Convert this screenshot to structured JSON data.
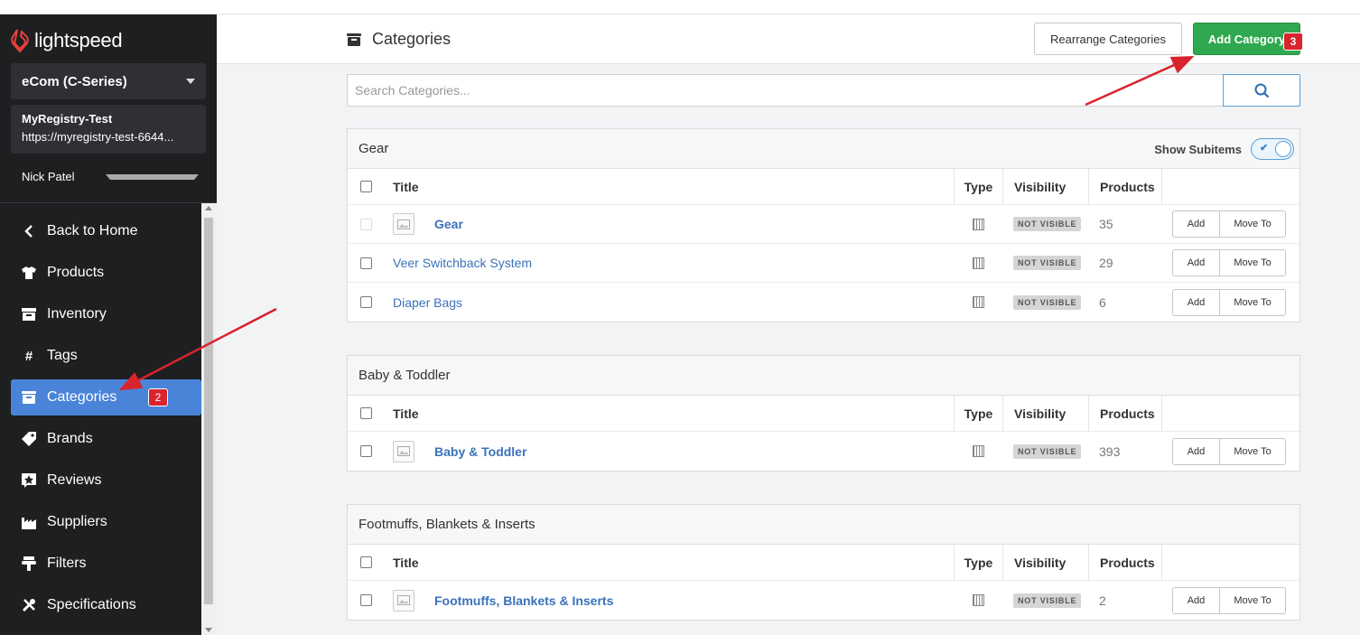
{
  "app": {
    "logo_text": "lightspeed",
    "product_select": "eCom (C-Series)",
    "store_name": "MyRegistry-Test",
    "store_url": "https://myregistry-test-6644...",
    "user_name": "Nick Patel"
  },
  "sidebar": {
    "items": [
      {
        "label": "Back to Home",
        "icon": "chevron-left-icon"
      },
      {
        "label": "Products",
        "icon": "tshirt-icon"
      },
      {
        "label": "Inventory",
        "icon": "archive-icon"
      },
      {
        "label": "Tags",
        "icon": "hash-icon"
      },
      {
        "label": "Categories",
        "icon": "folder-icon",
        "active": true,
        "annotation": "2"
      },
      {
        "label": "Brands",
        "icon": "tag-icon"
      },
      {
        "label": "Reviews",
        "icon": "star-icon"
      },
      {
        "label": "Suppliers",
        "icon": "factory-icon"
      },
      {
        "label": "Filters",
        "icon": "filter-icon"
      },
      {
        "label": "Specifications",
        "icon": "tools-icon"
      }
    ]
  },
  "header": {
    "title": "Categories",
    "rearrange_label": "Rearrange Categories",
    "add_label": "Add Category",
    "add_annotation": "3"
  },
  "search": {
    "placeholder": "Search Categories..."
  },
  "table_columns": {
    "title": "Title",
    "type": "Type",
    "visibility": "Visibility",
    "products": "Products"
  },
  "row_actions": {
    "add": "Add",
    "move": "Move To"
  },
  "groups": [
    {
      "name": "Gear",
      "show_subitems_label": "Show Subitems",
      "rows": [
        {
          "title": "Gear",
          "visibility": "NOT VISIBLE",
          "products": "35"
        },
        {
          "title": "Veer Switchback System",
          "visibility": "NOT VISIBLE",
          "products": "29"
        },
        {
          "title": "Diaper Bags",
          "visibility": "NOT VISIBLE",
          "products": "6"
        }
      ]
    },
    {
      "name": "Baby & Toddler",
      "rows": [
        {
          "title": "Baby & Toddler",
          "visibility": "NOT VISIBLE",
          "products": "393"
        }
      ]
    },
    {
      "name": "Footmuffs, Blankets & Inserts",
      "rows": [
        {
          "title": "Footmuffs, Blankets & Inserts",
          "visibility": "NOT VISIBLE",
          "products": "2"
        }
      ]
    }
  ],
  "colors": {
    "sidebar_bg": "#1e1f21",
    "active_nav": "#4a84d9",
    "primary_green": "#2fa84f",
    "link_blue": "#3a72b8",
    "annotation_red": "#d9232d",
    "brand_red": "#e8413c"
  }
}
